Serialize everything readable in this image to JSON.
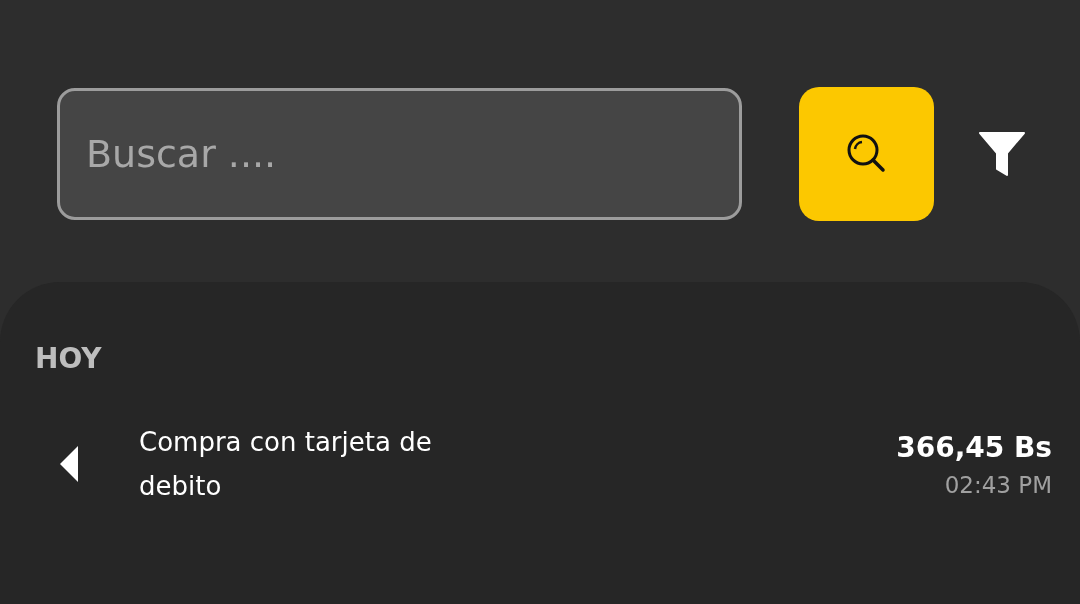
{
  "search": {
    "placeholder": "Buscar ...."
  },
  "section": {
    "title": "HOY"
  },
  "transactions": [
    {
      "description": "Compra con tarjeta de debito",
      "amount": "366,45 Bs",
      "time": "02:43 PM"
    }
  ]
}
